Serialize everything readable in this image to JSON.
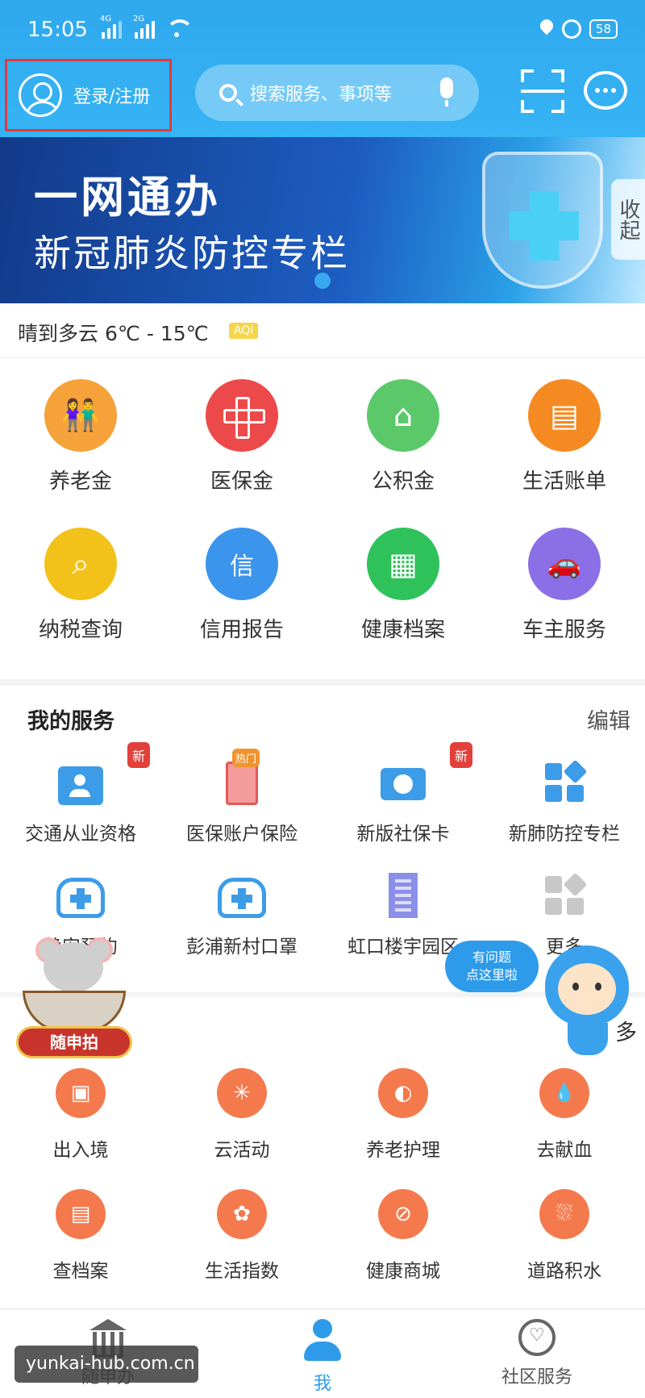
{
  "status_bar": {
    "time": "15:05",
    "sim1": "4G",
    "sim2": "2G",
    "battery": "58"
  },
  "header": {
    "login_label": "登录/注册",
    "search_placeholder": "搜索服务、事项等"
  },
  "banner": {
    "title": "一网通办",
    "subtitle": "新冠肺炎防控专栏",
    "collapse_label": "收起"
  },
  "weather": {
    "text": "晴到多云 6℃ - 15℃",
    "aqi": "AQI"
  },
  "main_tiles": [
    {
      "label": "养老金",
      "icon": "elderly-couple-icon",
      "color": "#f5a23a"
    },
    {
      "label": "医保金",
      "icon": "medical-cross-icon",
      "color": "#ec4a4a"
    },
    {
      "label": "公积金",
      "icon": "house-icon",
      "color": "#5bc96a"
    },
    {
      "label": "生活账单",
      "icon": "bill-icon",
      "color": "#f58a22"
    },
    {
      "label": "纳税查询",
      "icon": "tax-search-icon",
      "color": "#f2c21a"
    },
    {
      "label": "信用报告",
      "icon": "credit-report-icon",
      "color": "#3b95ec"
    },
    {
      "label": "健康档案",
      "icon": "health-record-icon",
      "color": "#2fc25b"
    },
    {
      "label": "车主服务",
      "icon": "car-icon",
      "color": "#8b6fe6"
    }
  ],
  "my_services": {
    "title": "我的服务",
    "edit_label": "编辑",
    "items": [
      {
        "label": "交通从业资格",
        "icon": "id-card-icon",
        "badge": "新"
      },
      {
        "label": "医保账户保险",
        "icon": "medical-document-icon",
        "badge": "热门"
      },
      {
        "label": "新版社保卡",
        "icon": "social-security-card-icon",
        "badge": "新"
      },
      {
        "label": "新肺防控专栏",
        "icon": "grid-blocks-icon",
        "badge": ""
      },
      {
        "label": "静安预约",
        "icon": "hospital-phone-icon",
        "badge": ""
      },
      {
        "label": "彭浦新村口罩",
        "icon": "hospital-phone-icon",
        "badge": ""
      },
      {
        "label": "虹口楼宇园区",
        "icon": "building-icon",
        "badge": ""
      },
      {
        "label": "更多",
        "icon": "more-blocks-icon",
        "badge": ""
      }
    ]
  },
  "services_more_label": "多",
  "services": [
    {
      "label": "出入境",
      "icon": "passport-icon",
      "glyph": "▣"
    },
    {
      "label": "云活动",
      "icon": "pinwheel-icon",
      "glyph": "✳"
    },
    {
      "label": "养老护理",
      "icon": "elder-care-icon",
      "glyph": "◐"
    },
    {
      "label": "去献血",
      "icon": "blood-drop-icon",
      "glyph": "💧"
    },
    {
      "label": "查档案",
      "icon": "archive-icon",
      "glyph": "▤"
    },
    {
      "label": "生活指数",
      "icon": "life-index-icon",
      "glyph": "✿"
    },
    {
      "label": "健康商城",
      "icon": "pill-icon",
      "glyph": "⊘"
    },
    {
      "label": "道路积水",
      "icon": "road-water-icon",
      "glyph": "⛆"
    }
  ],
  "floating": {
    "left_badge": "随申拍",
    "help_line1": "有问题",
    "help_line2": "点这里啦"
  },
  "bottom_nav": [
    {
      "label": "随申办",
      "icon": "bank-icon",
      "active": false
    },
    {
      "label": "我",
      "icon": "person-icon",
      "active": true
    },
    {
      "label": "社区服务",
      "icon": "heart-location-icon",
      "active": false
    }
  ],
  "watermark": "yunkai-hub.com.cn"
}
